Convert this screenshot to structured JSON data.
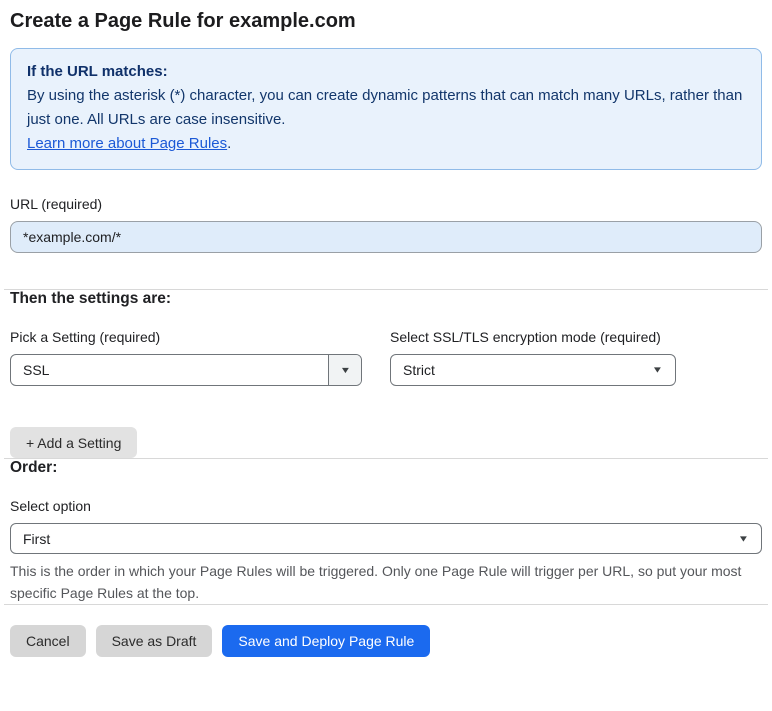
{
  "page": {
    "title": "Create a Page Rule for example.com"
  },
  "info_box": {
    "heading": "If the URL matches:",
    "body": "By using the asterisk (*) character, you can create dynamic patterns that can match many URLs, rather than just one. All URLs are case insensitive.",
    "link_label": "Learn more about Page Rules",
    "link_suffix": "."
  },
  "url_section": {
    "label": "URL (required)",
    "value": "*example.com/*"
  },
  "settings_section": {
    "heading": "Then the settings are:",
    "setting_picker": {
      "label": "Pick a Setting (required)",
      "selected": "SSL"
    },
    "ssl_mode_picker": {
      "label": "Select SSL/TLS encryption mode (required)",
      "selected": "Strict"
    },
    "add_setting_label": "+ Add a Setting"
  },
  "order_section": {
    "heading": "Order:",
    "select_label": "Select option",
    "selected": "First",
    "help_text": "This is the order in which your Page Rules will be triggered. Only one Page Rule will trigger per URL, so put your most specific Page Rules at the top."
  },
  "footer": {
    "cancel_label": "Cancel",
    "save_draft_label": "Save as Draft",
    "save_deploy_label": "Save and Deploy Page Rule"
  },
  "icons": {
    "dropdown_arrow": "▼"
  },
  "colors": {
    "accent_blue": "#1b6aef",
    "info_background": "#e9f2fc",
    "info_border": "#90bbe8",
    "info_text": "#12366b",
    "link_blue": "#1b59d6",
    "url_input_background": "#dfecfa"
  }
}
